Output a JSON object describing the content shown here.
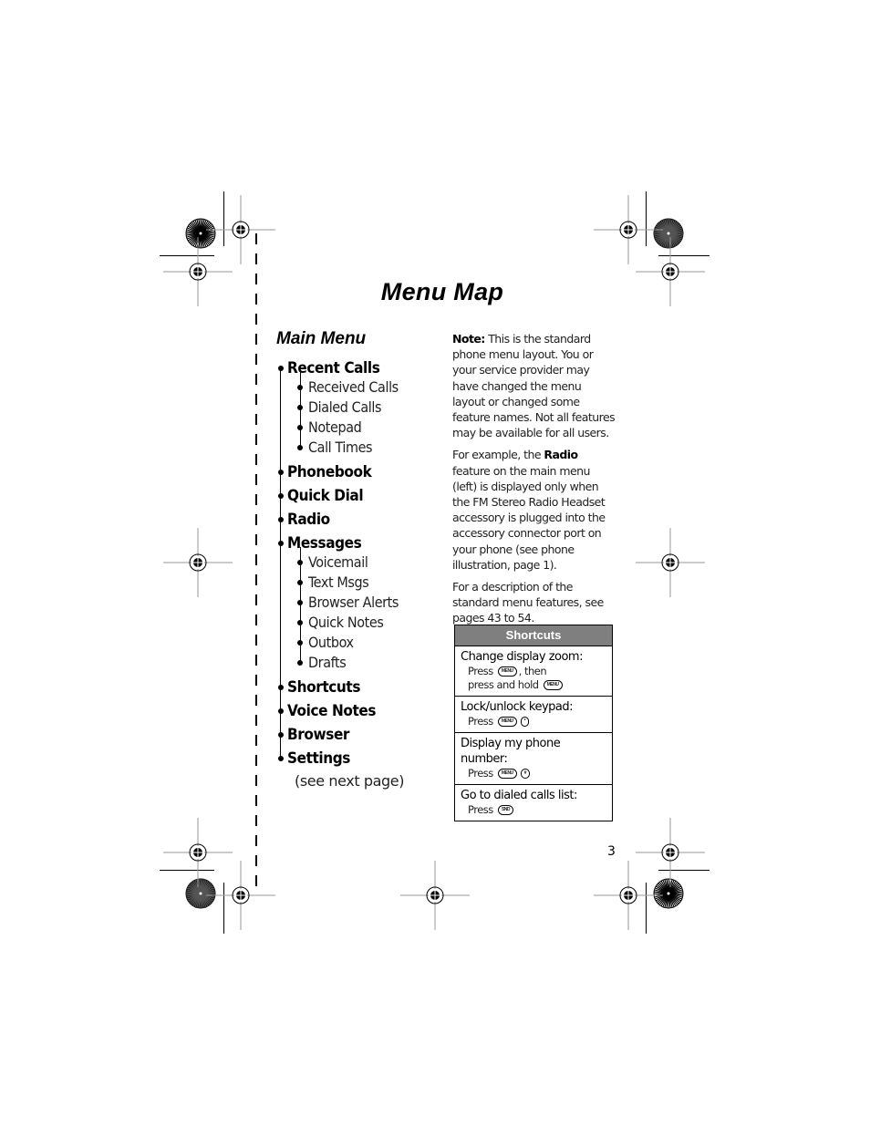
{
  "page": {
    "title": "Menu Map",
    "page_number": "3"
  },
  "main_menu": {
    "heading": "Main Menu",
    "items": [
      {
        "label": "Recent Calls",
        "children": [
          "Received Calls",
          "Dialed Calls",
          "Notepad",
          "Call Times"
        ]
      },
      {
        "label": "Phonebook",
        "children": []
      },
      {
        "label": "Quick Dial",
        "children": []
      },
      {
        "label": "Radio",
        "children": []
      },
      {
        "label": "Messages",
        "children": [
          "Voicemail",
          "Text Msgs",
          "Browser Alerts",
          "Quick Notes",
          "Outbox",
          "Drafts"
        ]
      },
      {
        "label": "Shortcuts",
        "children": []
      },
      {
        "label": "Voice Notes",
        "children": []
      },
      {
        "label": "Browser",
        "children": []
      },
      {
        "label": "Settings",
        "children": []
      }
    ],
    "settings_note": "(see next page)"
  },
  "notes": {
    "note_label": "Note:",
    "note_text": " This is the standard phone menu layout. You or your service provider may have changed the menu layout or changed some feature names. Not all features may be available for all users.",
    "example_prefix": "For example, the ",
    "example_bold": "Radio",
    "example_suffix": " feature on the main menu (left) is displayed only when the FM Stereo Radio Headset accessory is plugged into the accessory connector port on your phone (see phone illustration, page 1).",
    "description": "For a description of the standard menu features, see pages 43 to 54."
  },
  "shortcuts": {
    "header": "Shortcuts",
    "header_color": "#7f7f7f",
    "rows": [
      {
        "label": "Change display zoom:",
        "step1_text": "Press",
        "step1_keys": [
          "MENU"
        ],
        "step1_suffix": ", then",
        "step2_text": "press and hold",
        "step2_keys": [
          "MENU"
        ]
      },
      {
        "label": "Lock/unlock keypad:",
        "step1_text": "Press",
        "step1_keys": [
          "MENU",
          "*"
        ]
      },
      {
        "label": "Display my phone number:",
        "step1_text": "Press",
        "step1_keys": [
          "MENU",
          "#"
        ]
      },
      {
        "label": "Go to dialed calls list:",
        "step1_text": "Press",
        "step1_keys": [
          "SND"
        ]
      }
    ]
  }
}
